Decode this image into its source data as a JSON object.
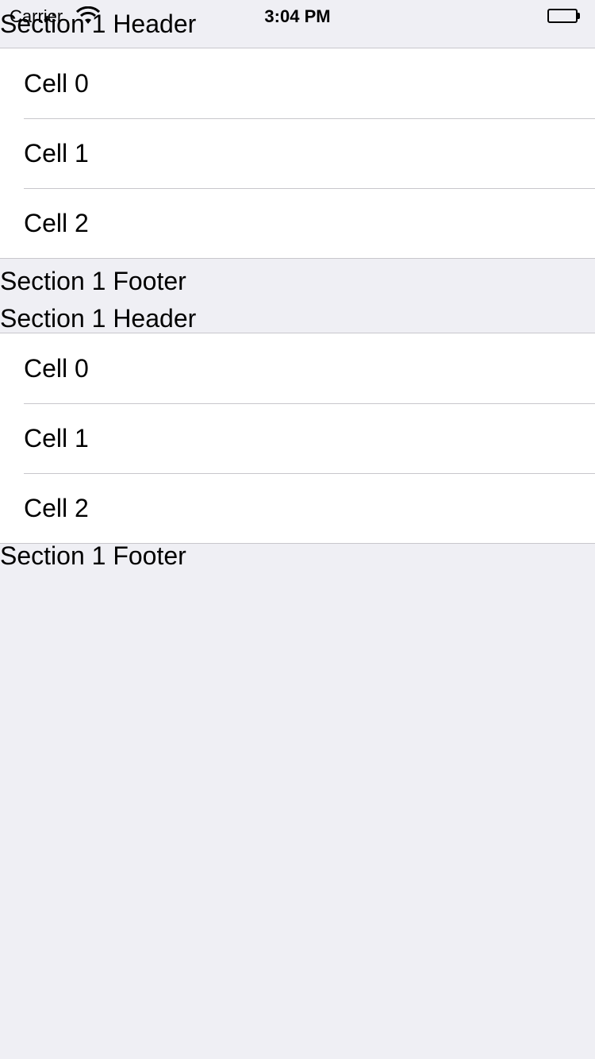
{
  "status_bar": {
    "carrier": "Carrier",
    "time": "3:04 PM",
    "wifi_icon": "wifi-icon",
    "battery_icon": "battery-icon"
  },
  "sections": [
    {
      "header": "Section 1 Header",
      "cells": [
        "Cell 0",
        "Cell 1",
        "Cell 2"
      ],
      "footer": "Section 1 Footer"
    },
    {
      "header": "Section 1 Header",
      "cells": [
        "Cell 0",
        "Cell 1",
        "Cell 2"
      ],
      "footer": "Section 1 Footer"
    }
  ],
  "colors": {
    "background": "#efeff4",
    "cell_background": "#ffffff",
    "separator": "#c8c7cc",
    "text": "#000000"
  }
}
